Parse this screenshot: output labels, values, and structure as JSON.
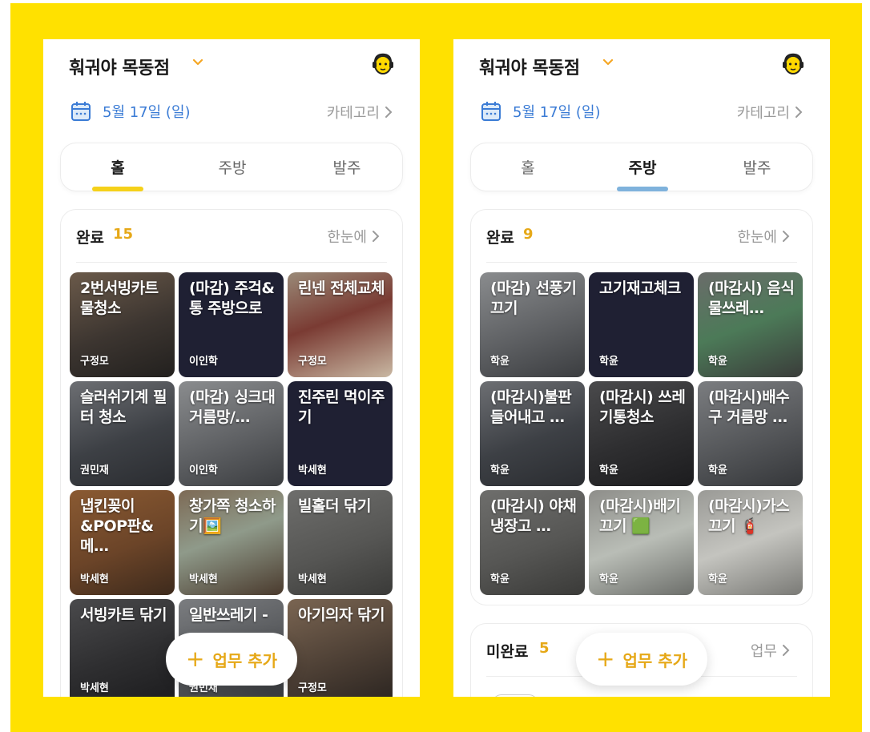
{
  "colors": {
    "frame": "#FFE100",
    "accent_yellow": "#E6A817",
    "date_blue": "#3A7BD5",
    "hall_underline": "#F5D11A",
    "kitchen_underline": "#7FB2DC",
    "tile_dark": "#1f2033"
  },
  "screens": [
    {
      "store_name": "훠궈야 목동점",
      "date": "5월 17일 (일)",
      "category_label": "카테고리",
      "tabs": [
        {
          "label": "홀"
        },
        {
          "label": "주방"
        },
        {
          "label": "발주"
        }
      ],
      "active_tab": 0,
      "sections": [
        {
          "title": "완료",
          "count": "15",
          "link": "한눈에"
        }
      ],
      "tasks": [
        {
          "title": "2번서빙카트 물청소",
          "assignee": "구정모",
          "bg": "photo-brown"
        },
        {
          "title": "(마감) 주걱& 통 주방으로",
          "assignee": "이인학",
          "bg": "dark"
        },
        {
          "title": "린넨 전체교체",
          "assignee": "구정모",
          "bg": "photo-red"
        },
        {
          "title": "슬러쉬기계 필터 청소",
          "assignee": "권민재",
          "bg": "photo-steel"
        },
        {
          "title": "(마감) 싱크대 거름망/…",
          "assignee": "이인학",
          "bg": "photo-grey"
        },
        {
          "title": "진주린 먹이주기",
          "assignee": "박세현",
          "bg": "dark"
        },
        {
          "title": "냅킨꽂이&POP판&메…",
          "assignee": "박세현",
          "bg": "photo-wood"
        },
        {
          "title": "창가쪽 청소하기🖼️",
          "assignee": "박세현",
          "bg": "photo-window"
        },
        {
          "title": "빌홀더 닦기",
          "assignee": "박세현",
          "bg": "photo-panel"
        },
        {
          "title": "서빙카트 닦기",
          "assignee": "박세현",
          "bg": "photo-dark"
        },
        {
          "title": "일반쓰레기 -",
          "assignee": "권민재",
          "bg": "photo-grey2"
        },
        {
          "title": "아기의자 닦기",
          "assignee": "구정모",
          "bg": "photo-brown2"
        }
      ],
      "fab_label": "업무 추가"
    },
    {
      "store_name": "훠궈야 목동점",
      "date": "5월 17일 (일)",
      "category_label": "카테고리",
      "tabs": [
        {
          "label": "홀"
        },
        {
          "label": "주방"
        },
        {
          "label": "발주"
        }
      ],
      "active_tab": 1,
      "sections": [
        {
          "title": "완료",
          "count": "9",
          "link": "한눈에"
        },
        {
          "title": "미완료",
          "count": "5",
          "link": "업무"
        }
      ],
      "tasks": [
        {
          "title": "(마감) 선풍기 끄기",
          "assignee": "학윤",
          "bg": "photo-grey"
        },
        {
          "title": "고기재고체크",
          "assignee": "학윤",
          "bg": "dark"
        },
        {
          "title": "(마감시) 음식물쓰레…",
          "assignee": "학윤",
          "bg": "photo-green"
        },
        {
          "title": "(마감시)불판 들어내고 …",
          "assignee": "학윤",
          "bg": "photo-steel"
        },
        {
          "title": "(마감시) 쓰레기통청소",
          "assignee": "학윤",
          "bg": "photo-dark"
        },
        {
          "title": "(마감시)배수구 거름망 …",
          "assignee": "학윤",
          "bg": "photo-grey2"
        },
        {
          "title": "(마감시) 야채냉장고 …",
          "assignee": "학윤",
          "bg": "photo-panel"
        },
        {
          "title": "(마감시)배기 끄기 🟩",
          "assignee": "학윤",
          "bg": "photo-light"
        },
        {
          "title": "(마감시)가스 끄기 🧯",
          "assignee": "학윤",
          "bg": "photo-light2"
        }
      ],
      "fab_label": "업무 추가"
    }
  ]
}
